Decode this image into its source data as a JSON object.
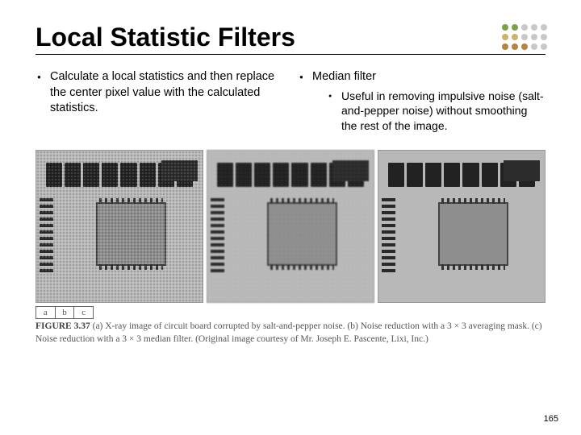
{
  "title": "Local Statistic Filters",
  "decor_colors": [
    "#7fa04a",
    "#7fa04a",
    "#c8c8c8",
    "#c8c8c8",
    "#c8c8c8",
    "#c9b46a",
    "#c9b46a",
    "#c8c8c8",
    "#c8c8c8",
    "#c8c8c8",
    "#b5843e",
    "#b5843e",
    "#b5843e",
    "#c8c8c8",
    "#c8c8c8"
  ],
  "left_bullet": "Calculate a local statistics and then replace the center pixel value with the calculated statistics.",
  "right_bullet": "Median filter",
  "right_sub": "Useful in removing impulsive noise (salt-and-pepper noise) without smoothing the rest of the image.",
  "abc": {
    "a": "a",
    "b": "b",
    "c": "c"
  },
  "caption_label": "FIGURE 3.37",
  "caption_body": " (a) X-ray image of circuit board corrupted by salt-and-pepper noise. (b) Noise reduction with a 3 × 3 averaging mask. (c) Noise reduction with a 3 × 3 median filter. (Original image courtesy of Mr. Joseph E. Pascente, Lixi, Inc.)",
  "page_number": "165"
}
